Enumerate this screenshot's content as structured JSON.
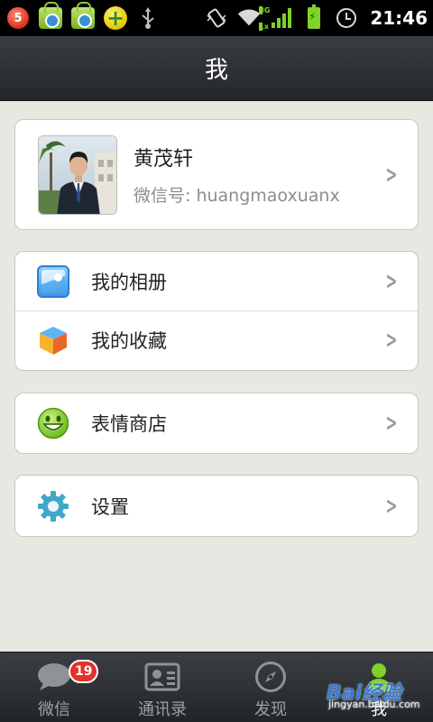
{
  "status_bar": {
    "notification_count": "5",
    "network_type_top": "3G",
    "network_type_bottom": "1x",
    "time": "21:46"
  },
  "header": {
    "title": "我"
  },
  "profile": {
    "name": "黄茂轩",
    "wechat_id_label": "微信号:",
    "wechat_id": "huangmaoxuanx"
  },
  "menu": {
    "album": "我的相册",
    "favorites": "我的收藏",
    "sticker_store": "表情商店",
    "settings": "设置"
  },
  "tabs": [
    {
      "label": "微信",
      "icon": "chat-bubble-icon",
      "badge": "19"
    },
    {
      "label": "通讯录",
      "icon": "contacts-card-icon"
    },
    {
      "label": "发现",
      "icon": "compass-icon"
    },
    {
      "label": "我",
      "icon": "person-icon",
      "active": true
    }
  ],
  "watermark": {
    "brand": "Bai经验",
    "url": "jingyan.baidu.com"
  },
  "colors": {
    "accent_green": "#7fd227",
    "badge_red": "#e2322b",
    "header_dark": "#2e3236",
    "background": "#e9e7e2"
  }
}
